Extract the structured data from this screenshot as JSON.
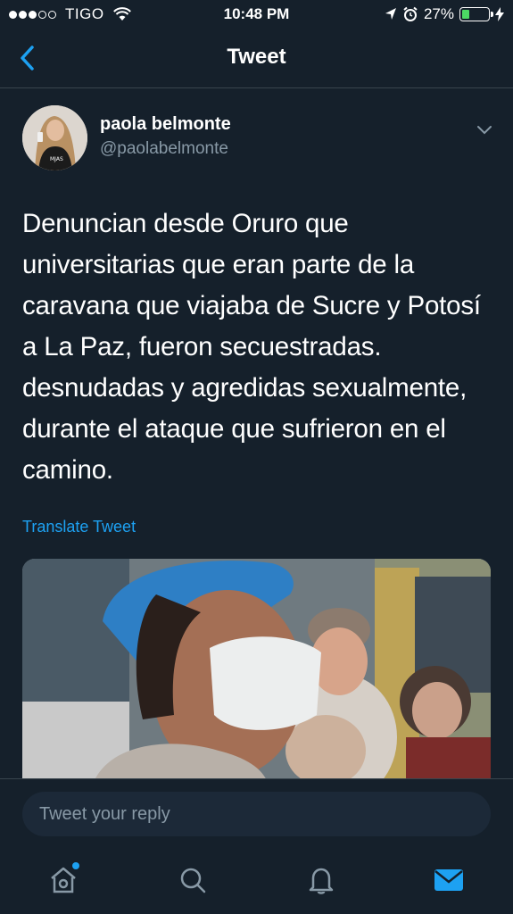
{
  "status_bar": {
    "carrier": "TIGO",
    "time": "10:48 PM",
    "battery_percent_label": "27%",
    "battery_level": 0.27
  },
  "nav": {
    "title": "Tweet"
  },
  "tweet": {
    "author_name": "paola belmonte",
    "author_handle": "@paolabelmonte",
    "text": "Denuncian desde Oruro que universitarias que eran parte de la caravana que viajaba de Sucre y Potosí a La Paz, fueron secuestradas. desnudadas y agredidas sexualmente, durante el ataque que sufrieron en el camino.",
    "translate_label": "Translate Tweet",
    "avatar_caption": "MJAS"
  },
  "reply": {
    "placeholder": "Tweet your reply"
  },
  "tabs": [
    {
      "icon": "home-icon",
      "active": false,
      "has_notification": true
    },
    {
      "icon": "search-icon",
      "active": false
    },
    {
      "icon": "bell-icon",
      "active": false
    },
    {
      "icon": "mail-icon",
      "active": true
    }
  ],
  "colors": {
    "background": "#15202b",
    "accent": "#1da1f2",
    "secondary_text": "#8899a6",
    "divider": "#38444d"
  }
}
